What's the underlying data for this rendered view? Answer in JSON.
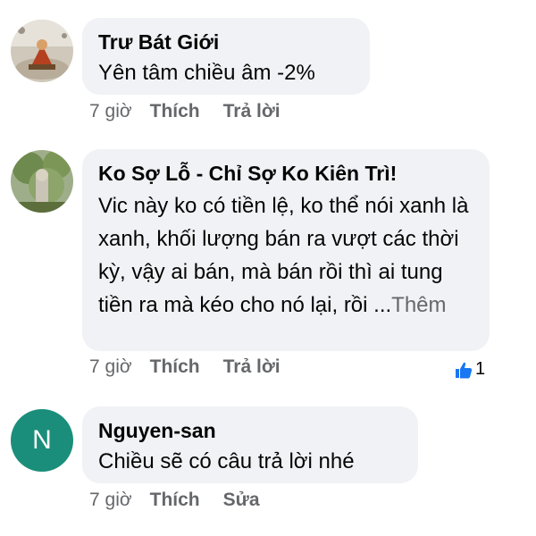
{
  "comments": [
    {
      "author": "Trư Bát Giới",
      "text": "Yên tâm chiều âm -2%",
      "time": "7 giờ",
      "actions": [
        "Thích",
        "Trả lời"
      ]
    },
    {
      "author": "Ko Sợ Lỗ - Chỉ Sợ Ko Kiên Trì!",
      "text": "Vic này ko có tiền lệ, ko thể nói xanh là xanh, khối lượng bán ra vượt các thời kỳ, vậy ai bán, mà bán rồi thì ai tung tiền ra mà kéo cho nó lại, rồi ...",
      "see_more": "Thêm",
      "time": "7 giờ",
      "actions": [
        "Thích",
        "Trả lời"
      ],
      "reaction_icon": "like-icon",
      "reaction_count": "1"
    },
    {
      "author": "Nguyen-san",
      "avatar_letter": "N",
      "avatar_color": "#1a8e7a",
      "text": "Chiều sẽ có câu trả lời nhé",
      "time": "7 giờ",
      "actions": [
        "Thích",
        "Sửa"
      ]
    }
  ],
  "colors": {
    "bubble": "#f0f2f5",
    "meta_text": "#65676b",
    "like_blue": "#1877f2"
  }
}
